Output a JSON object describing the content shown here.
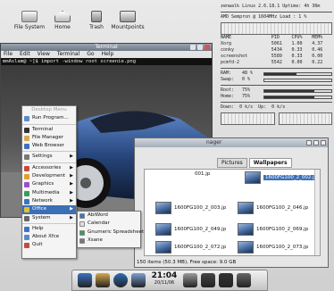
{
  "desktop": {
    "icons": [
      {
        "label": "File System",
        "icon": "hard-disk-icon"
      },
      {
        "label": "Home",
        "icon": "home-folder-icon"
      },
      {
        "label": "Trash",
        "icon": "trash-icon"
      },
      {
        "label": "Mountpoints",
        "icon": "drive-icon"
      }
    ]
  },
  "conky": {
    "header": "zenwalk Linux 2.6.18.1  Uptime: 4h 36m",
    "cpu_line": "AMD Sempron @ 1604MHz   Load : 1 %",
    "table_header": [
      "NAME",
      "PID",
      "CPU%",
      "MEM%"
    ],
    "rows": [
      [
        "Xorg",
        "5061",
        "1.00",
        "4.37"
      ],
      [
        "conky",
        "5434",
        "0.33",
        "0.46"
      ],
      [
        "screenshot",
        "5589",
        "0.33",
        "0.00"
      ],
      [
        "pcmfd-2",
        "5542",
        "0.00",
        "0.22"
      ]
    ],
    "ram_label": "RAM:",
    "ram_value": "48 %",
    "ram_level": 0.48,
    "swap_label": "Swap:",
    "swap_value": "0 %",
    "swap_level": 0.0,
    "root_label": "Root:",
    "root_value": "75%",
    "root_level": 0.75,
    "home_label": "Home:",
    "home_value": "75%",
    "home_level": 0.75,
    "down_label": "Down:",
    "down_value": "0 k/s",
    "up_label": "Up:",
    "up_value": "0 k/s"
  },
  "terminal": {
    "title": "Terminal",
    "menu": [
      "File",
      "Edit",
      "View",
      "Terminal",
      "Go",
      "Help"
    ],
    "prompt": "mmAslam@ ~]$ import -window root screenie.png"
  },
  "desktop_menu": {
    "header": "Desktop Menu",
    "items": [
      {
        "label": "Run Program...",
        "icon": "run-icon",
        "color": "#5a8bc9",
        "submenu": false
      },
      {
        "sep": true
      },
      {
        "label": "Terminal",
        "icon": "terminal-icon",
        "color": "#333333",
        "submenu": false
      },
      {
        "label": "File Manager",
        "icon": "folder-icon",
        "color": "#d6a94a",
        "submenu": false
      },
      {
        "label": "Web Browser",
        "icon": "globe-icon",
        "color": "#3b73c4",
        "submenu": false
      },
      {
        "sep": true
      },
      {
        "label": "Settings",
        "icon": "settings-icon",
        "color": "#777777",
        "submenu": true
      },
      {
        "sep": true
      },
      {
        "label": "Accessories",
        "icon": "accessories-icon",
        "color": "#c44a3b",
        "submenu": true
      },
      {
        "label": "Development",
        "icon": "development-icon",
        "color": "#e0a030",
        "submenu": true
      },
      {
        "label": "Graphics",
        "icon": "graphics-icon",
        "color": "#9c4fc4",
        "submenu": true
      },
      {
        "label": "Multimedia",
        "icon": "multimedia-icon",
        "color": "#3a9c5b",
        "submenu": true
      },
      {
        "label": "Network",
        "icon": "network-icon",
        "color": "#3b73c4",
        "submenu": true
      },
      {
        "label": "Office",
        "icon": "office-icon",
        "color": "#e0c030",
        "submenu": true,
        "active": true
      },
      {
        "label": "System",
        "icon": "system-icon",
        "color": "#666666",
        "submenu": true
      },
      {
        "sep": true
      },
      {
        "label": "Help",
        "icon": "help-icon",
        "color": "#3b73c4",
        "submenu": false
      },
      {
        "label": "About Xfce",
        "icon": "info-icon",
        "color": "#5a8bc9",
        "submenu": false
      },
      {
        "label": "Quit",
        "icon": "quit-icon",
        "color": "#c44a3b",
        "submenu": false
      }
    ]
  },
  "office_submenu": {
    "items": [
      {
        "label": "AbiWord",
        "icon": "abiword-icon",
        "color": "#3b73c4"
      },
      {
        "label": "Calendar",
        "icon": "calendar-icon",
        "color": "#e0e0e0"
      },
      {
        "label": "Gnumeric Spreadsheet",
        "icon": "spreadsheet-icon",
        "color": "#3a9c5b"
      },
      {
        "label": "Xsane",
        "icon": "scanner-icon",
        "color": "#777777"
      }
    ]
  },
  "file_manager": {
    "title_fragment": "nager",
    "tabs": [
      {
        "label": "Pictures",
        "active": false
      },
      {
        "label": "Wallpapers",
        "active": true
      }
    ],
    "files": [
      {
        "name": "001.jp",
        "selected": false
      },
      {
        "name": "1600FG100_2_002.jp",
        "selected": true
      },
      {
        "name": "1600FG100_2_003.jp",
        "selected": false
      },
      {
        "name": "1600FG100_2_046.jp",
        "selected": false
      },
      {
        "name": "1600FG100_2_049.jp",
        "selected": false
      },
      {
        "name": "1600FG100_2_069.jp",
        "selected": false
      },
      {
        "name": "1600FG100_2_072.jp",
        "selected": false
      },
      {
        "name": "1600FG100_2_073.jp",
        "selected": false
      }
    ],
    "status": "150 items (50.3 MB), Free space: 9.0 GB"
  },
  "taskbar": {
    "time": "21:04",
    "date": "20/11/06",
    "buttons": [
      {
        "icon": "xfce-menu-icon",
        "color": "#3b73c4"
      },
      {
        "icon": "folder-icon",
        "color": "#d6a94a"
      },
      {
        "icon": "globe-icon",
        "color": "#2c6fb8"
      },
      {
        "icon": "notes-icon",
        "color": "#7a9fd6"
      },
      {
        "icon": "clipboard-icon",
        "color": "#9a9a9a"
      },
      {
        "icon": "workspace-icon",
        "color": "#444444"
      },
      {
        "icon": "terminal-icon",
        "color": "#333333"
      },
      {
        "icon": "file-manager-icon",
        "color": "#666666"
      }
    ]
  }
}
